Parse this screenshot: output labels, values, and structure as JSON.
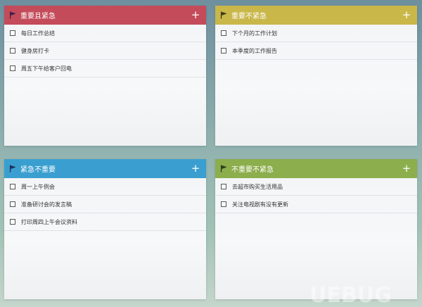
{
  "colors": {
    "urgent_important": "#c44b5a",
    "important_not_urgent": "#c9b74a",
    "urgent_not_important": "#3a9fd0",
    "not_important_not_urgent": "#8cae4c",
    "flag_dark": "#3a1f4a"
  },
  "icons": {
    "flag": "flag-icon",
    "add": "plus-icon",
    "checkbox": "checkbox-icon"
  },
  "quadrants": [
    {
      "title": "重要且紧急",
      "add_label": "+",
      "tasks": [
        "每日工作总结",
        "健身房打卡",
        "周五下午给客户回电"
      ]
    },
    {
      "title": "重要不紧急",
      "add_label": "+",
      "tasks": [
        "下个月的工作计划",
        "本季度的工作报告"
      ]
    },
    {
      "title": "紧急不重要",
      "add_label": "+",
      "tasks": [
        "周一上午例会",
        "准备研讨会的发言稿",
        "打印周四上午会议资料"
      ]
    },
    {
      "title": "不重要不紧急",
      "add_label": "+",
      "tasks": [
        "去超市购买生活用品",
        "关注电视剧有没有更新"
      ]
    }
  ],
  "watermark": "UEBUG"
}
